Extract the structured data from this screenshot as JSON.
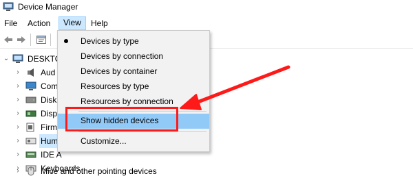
{
  "window": {
    "title": "Device Manager"
  },
  "menubar": {
    "file": "File",
    "action": "Action",
    "view": "View",
    "help": "Help"
  },
  "tree": {
    "root": "DESKTO",
    "items": [
      {
        "label": "Aud",
        "icon": "speaker-icon"
      },
      {
        "label": "Com",
        "icon": "monitor-icon"
      },
      {
        "label": "Disk",
        "icon": "disk-drive-icon"
      },
      {
        "label": "Disp",
        "icon": "display-adapter-icon"
      },
      {
        "label": "Firm",
        "icon": "firmware-icon"
      },
      {
        "label": "Hum",
        "icon": "hid-icon"
      },
      {
        "label": "IDE A",
        "icon": "ide-controller-icon"
      },
      {
        "label": "Keyboards",
        "icon": "keyboard-icon"
      },
      {
        "label": "Mice and other pointing devices",
        "icon": "mouse-icon"
      }
    ]
  },
  "view_menu": {
    "items": [
      {
        "label": "Devices by type",
        "checked": true
      },
      {
        "label": "Devices by connection"
      },
      {
        "label": "Devices by container"
      },
      {
        "label": "Resources by type"
      },
      {
        "label": "Resources by connection"
      },
      {
        "label": "Show hidden devices",
        "highlighted": true
      },
      {
        "label": "Customize..."
      }
    ]
  },
  "annotation": {
    "color": "#ff1a1a"
  },
  "colors": {
    "menu_highlight": "#91c9f7",
    "selected": "#cce8ff"
  }
}
